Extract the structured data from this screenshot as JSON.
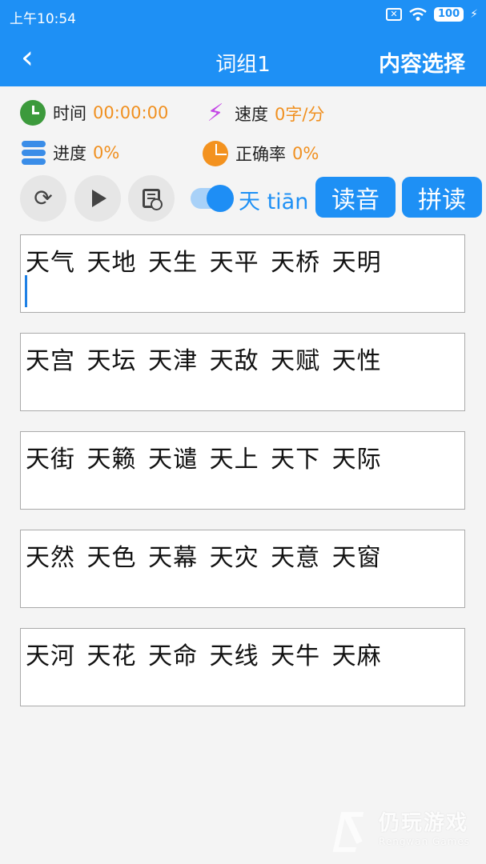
{
  "status_bar": {
    "time": "上午10:54",
    "battery": "100",
    "sim_icon": "sim-x-icon",
    "wifi_icon": "wifi-icon",
    "charging_icon": "bolt-icon"
  },
  "nav": {
    "back_icon": "chevron-left-icon",
    "back_glyph": "‹",
    "title": "词组1",
    "right_action": "内容选择"
  },
  "stats": {
    "time_label": "时间",
    "time_value": "00:00:00",
    "speed_label": "速度",
    "speed_value": "0字/分",
    "progress_label": "进度",
    "progress_value": "0%",
    "accuracy_label": "正确率",
    "accuracy_value": "0%"
  },
  "controls": {
    "refresh_glyph": "⟳",
    "toggle_on": true,
    "pinyin_display": "天 tiān",
    "read_button": "读音",
    "spell_button": "拼读"
  },
  "word_groups": [
    "天气 天地 天生 天平 天桥 天明",
    "天宫 天坛 天津 天敌 天赋 天性",
    "天街 天籁 天谴 天上 天下 天际",
    "天然 天色 天幕 天灾 天意 天窗",
    "天河 天花 天命 天线 天牛 天麻"
  ],
  "watermark": {
    "main": "仍玩游戏",
    "sub": "Rengwan Games"
  },
  "colors": {
    "primary": "#1e90f5",
    "accent_orange": "#f09020",
    "clock_green": "#3c9a3c",
    "speed_purple": "#c447e6"
  }
}
